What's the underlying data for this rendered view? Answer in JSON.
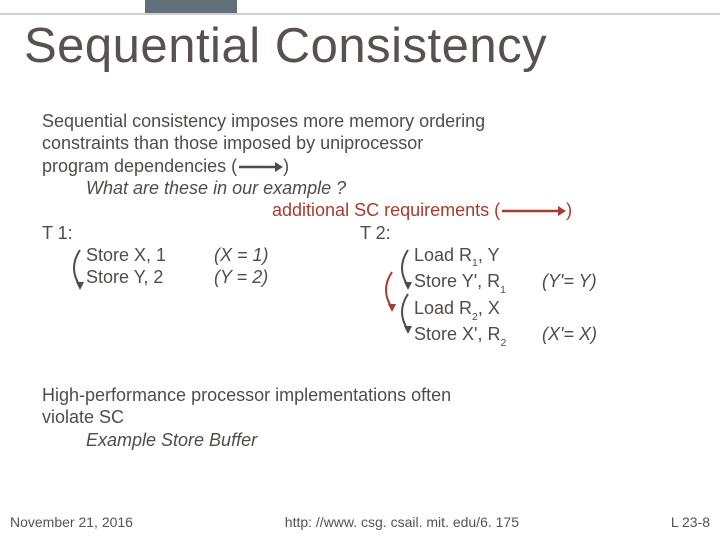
{
  "title": "Sequential Consistency",
  "p1_l1": "Sequential consistency imposes more memory ordering",
  "p1_l2": "constraints than those imposed by uniprocessor",
  "p1_l3_a": "program dependencies (",
  "p1_l3_b": ")",
  "p1_q": "What are these in our example ?",
  "sc_a": "additional SC requirements (",
  "sc_b": ")",
  "t1_h": "T 1:",
  "t1_s1": "Store X, 1",
  "t1_s1_annot": "(X =  1)",
  "t1_s2": "Store Y, 2",
  "t1_s2_annot": "(Y = 2)",
  "t2_h": "T 2:",
  "t2_l1_a": "Load R",
  "t2_l1_b": ", Y",
  "t2_l2_a": "Store Y', R",
  "t2_l2_annot": "(Y'= Y)",
  "t2_l3_a": "Load R",
  "t2_l3_b": ", X",
  "t2_l4_a": "Store X', R",
  "t2_l4_annot": "(X'= X)",
  "sub1": "1",
  "sub2": "2",
  "p2_l1": "High-performance processor implementations often",
  "p2_l2": "violate SC",
  "p2_ex": "Example Store Buffer",
  "footer_date": "November 21, 2016",
  "footer_url": "http: //www. csg. csail. mit. edu/6. 175",
  "footer_page": "L 23-8"
}
